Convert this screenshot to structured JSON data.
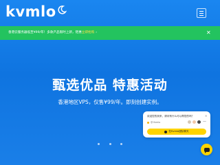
{
  "header": {
    "logo_text": "kvmlo",
    "logo_icon": "moon-icon",
    "menu_icon": "hamburger-menu-icon"
  },
  "notice": {
    "text": "香港云服务器低至¥99/年！多款产品限时上新，钜惠",
    "link": "立即抢购",
    "arrow": "›",
    "close": "✕",
    "color": "#23c35f"
  },
  "hero": {
    "title": "甄选优品 特惠活动",
    "subtitle": "香港地区VPS，仅售¥99/年。即刻创建实例。",
    "slides": 3
  },
  "chat": {
    "message": "欢迎您的到来，请问有什么可以帮您的吗？",
    "close": "✕",
    "status": "@ Kvmlo",
    "more": "—",
    "button": "在Kvmlo团队聊天",
    "launcher_icon": "chat-bubble-icon",
    "accent": "#ffd400"
  },
  "colors": {
    "background": "#0f74e0",
    "notice": "#23c35f",
    "chat_accent": "#ffd400"
  }
}
